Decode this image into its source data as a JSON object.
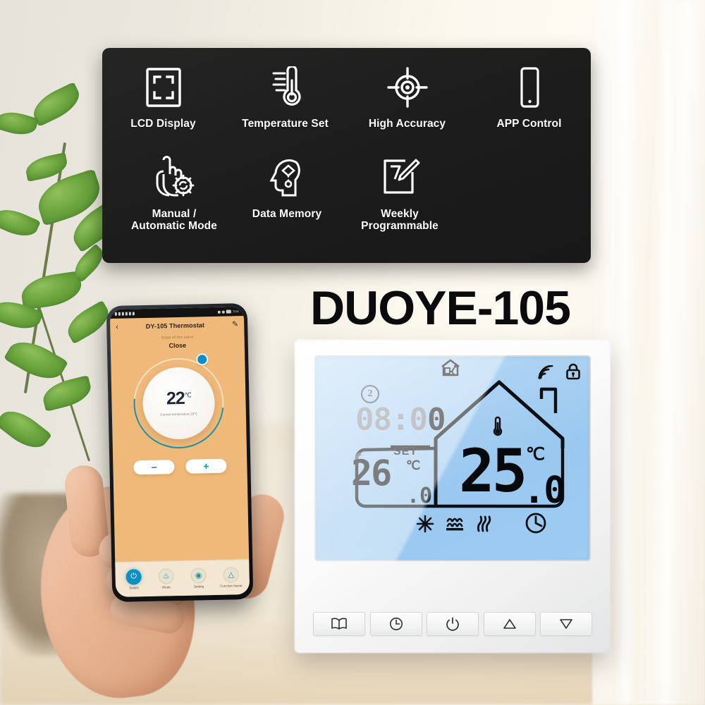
{
  "product": {
    "title": "DUOYE-105"
  },
  "features": {
    "row1": [
      {
        "label": "LCD Display",
        "icon": "lcd-display-icon"
      },
      {
        "label": "Temperature Set",
        "icon": "thermometer-icon"
      },
      {
        "label": "High Accuracy",
        "icon": "target-crosshair-icon"
      },
      {
        "label": "APP Control",
        "icon": "smartphone-icon"
      }
    ],
    "row2": [
      {
        "label": "Manual /\nAutomatic Mode",
        "label_line1": "Manual /",
        "label_line2": "Automatic Mode",
        "icon": "hand-gear-icon"
      },
      {
        "label": "Data Memory",
        "label_line1": "Data Memory",
        "label_line2": "",
        "icon": "head-brain-icon"
      },
      {
        "label": "Weekly\nProgrammable",
        "label_line1": "Weekly",
        "label_line2": "Programmable",
        "icon": "calendar-pencil-icon"
      }
    ]
  },
  "phone_app": {
    "status_bar": {
      "carrier_text": "",
      "battery_text": "76%"
    },
    "header": {
      "back_icon": "chevron-left-icon",
      "title": "DY-105 Thermostat",
      "edit_icon": "pencil-edit-icon"
    },
    "valve": {
      "state_label": "State of the valve",
      "state_value": "Close"
    },
    "dial": {
      "temperature": "22",
      "unit": "℃",
      "subtitle": "Current temperature 28℃",
      "arc_color": "#1f8fa3",
      "knob_color": "#0e8fc0"
    },
    "adjust": {
      "minus_label": "−",
      "plus_label": "+"
    },
    "nav": [
      {
        "label": "Switch",
        "icon": "power-icon",
        "active": true
      },
      {
        "label": "Mode",
        "icon": "droplet-mode-icon",
        "active": false
      },
      {
        "label": "Setting",
        "icon": "gear-icon",
        "active": false
      },
      {
        "label": "Function Name",
        "icon": "function-icon",
        "active": false
      }
    ]
  },
  "thermostat": {
    "lcd": {
      "background_color": "#a8d0f2",
      "day_number": "2",
      "time": "08:00",
      "time_dim_part": "08:0",
      "time_lit_part": "0",
      "set_label": "SET",
      "set_temperature": "26",
      "set_decimal": ".0",
      "set_unit": "℃",
      "current_temperature": "25",
      "current_decimal": ".0",
      "current_unit": "℃",
      "icons": {
        "away_home": "away-home-icon",
        "wifi": "wifi-icon",
        "lock": "lock-icon",
        "thermometer": "thermometer-icon",
        "cooling": "snowflake-icon",
        "floor_heating": "floor-heating-icon",
        "radiator_heating": "radiator-heat-icon",
        "timer": "clock-icon"
      }
    },
    "buttons": [
      {
        "name": "menu-book-button",
        "icon": "book-icon"
      },
      {
        "name": "timer-button",
        "icon": "clock-icon"
      },
      {
        "name": "power-button",
        "icon": "power-icon"
      },
      {
        "name": "temp-up-button",
        "icon": "triangle-up-icon"
      },
      {
        "name": "temp-down-button",
        "icon": "triangle-down-icon"
      }
    ]
  }
}
